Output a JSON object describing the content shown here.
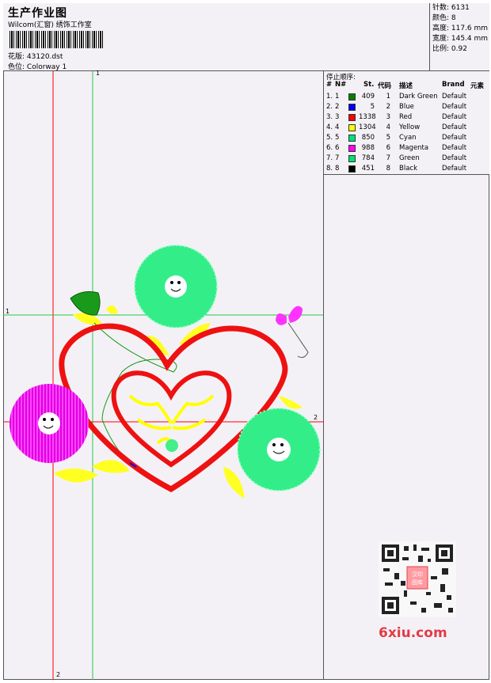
{
  "header": {
    "title": "生产作业图",
    "subtitle": "Wilcom(汇窗) 绣饰工作室",
    "design_label": "花版:",
    "design_value": "43120.dst",
    "colorway_label": "色位:",
    "colorway_value": "Colorway 1"
  },
  "stats": {
    "stitches": "针数: 6131",
    "colors": "颜色: 8",
    "height": "高度: 117.6 mm",
    "width": "宽度: 145.4 mm",
    "scale": "比例: 0.92"
  },
  "table": {
    "caption": "停止顺序:",
    "headers": {
      "hash": "#",
      "no": "N#",
      "st": "St.",
      "code": "代码",
      "desc": "描述",
      "brand": "Brand",
      "element": "元素"
    },
    "rows": [
      {
        "hash": "1.",
        "no": "1",
        "color": "#008000",
        "st": "409",
        "code": "1",
        "desc": "Dark Green",
        "brand": "Default"
      },
      {
        "hash": "2.",
        "no": "2",
        "color": "#0000ff",
        "st": "5",
        "code": "2",
        "desc": "Blue",
        "brand": "Default"
      },
      {
        "hash": "3.",
        "no": "3",
        "color": "#ff0000",
        "st": "1338",
        "code": "3",
        "desc": "Red",
        "brand": "Default"
      },
      {
        "hash": "4.",
        "no": "4",
        "color": "#ffff00",
        "st": "1304",
        "code": "4",
        "desc": "Yellow",
        "brand": "Default"
      },
      {
        "hash": "5.",
        "no": "5",
        "color": "#00e080",
        "st": "850",
        "code": "5",
        "desc": "Cyan",
        "brand": "Default"
      },
      {
        "hash": "6.",
        "no": "6",
        "color": "#ff00ff",
        "st": "988",
        "code": "6",
        "desc": "Magenta",
        "brand": "Default"
      },
      {
        "hash": "7.",
        "no": "7",
        "color": "#00e070",
        "st": "784",
        "code": "7",
        "desc": "Green",
        "brand": "Default"
      },
      {
        "hash": "8.",
        "no": "8",
        "color": "#000000",
        "st": "451",
        "code": "8",
        "desc": "Black",
        "brand": "Default"
      }
    ]
  },
  "guides": {
    "v1": "1",
    "h1": "1",
    "h2": "2",
    "v2": "2"
  },
  "watermark": "6xiu.com",
  "qr_badge": "汉印 图库"
}
